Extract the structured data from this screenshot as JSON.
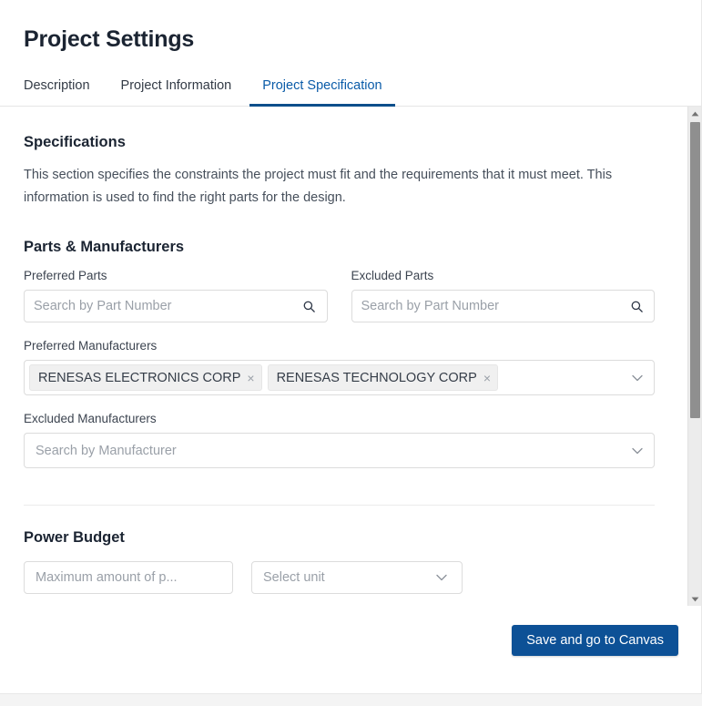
{
  "header": {
    "title": "Project Settings"
  },
  "tabs": [
    {
      "label": "Description",
      "active": false
    },
    {
      "label": "Project Information",
      "active": false
    },
    {
      "label": "Project Specification",
      "active": true
    }
  ],
  "specifications": {
    "title": "Specifications",
    "description": "This section specifies the constraints the project must fit and the requirements that it must meet. This information is used to find the right parts for the design."
  },
  "parts_manufacturers": {
    "title": "Parts & Manufacturers",
    "preferred_parts": {
      "label": "Preferred Parts",
      "placeholder": "Search by Part Number",
      "value": "",
      "icon": "search-icon"
    },
    "excluded_parts": {
      "label": "Excluded Parts",
      "placeholder": "Search by Part Number",
      "value": "",
      "icon": "search-icon"
    },
    "preferred_manufacturers": {
      "label": "Preferred Manufacturers",
      "tags": [
        {
          "label": "RENESAS ELECTRONICS CORP",
          "remove": "×"
        },
        {
          "label": "RENESAS TECHNOLOGY CORP",
          "remove": "×"
        }
      ],
      "icon": "chevron-down-icon"
    },
    "excluded_manufacturers": {
      "label": "Excluded Manufacturers",
      "placeholder": "Search by Manufacturer",
      "value": "",
      "tags": [],
      "icon": "chevron-down-icon"
    }
  },
  "power_budget": {
    "title": "Power Budget",
    "amount": {
      "placeholder": "Maximum amount of p...",
      "value": ""
    },
    "unit": {
      "placeholder": "Select unit",
      "value": "",
      "icon": "chevron-down-icon"
    }
  },
  "footer": {
    "save_label": "Save and go to Canvas"
  },
  "scrollbar": {
    "up_icon": "triangle-up-icon",
    "down_icon": "triangle-down-icon"
  },
  "colors": {
    "accent": "#0d5196",
    "tab_active": "#0a5ba8",
    "text": "#1b2432",
    "muted": "#9aa0a8",
    "tag_bg": "#f0f0f0"
  }
}
